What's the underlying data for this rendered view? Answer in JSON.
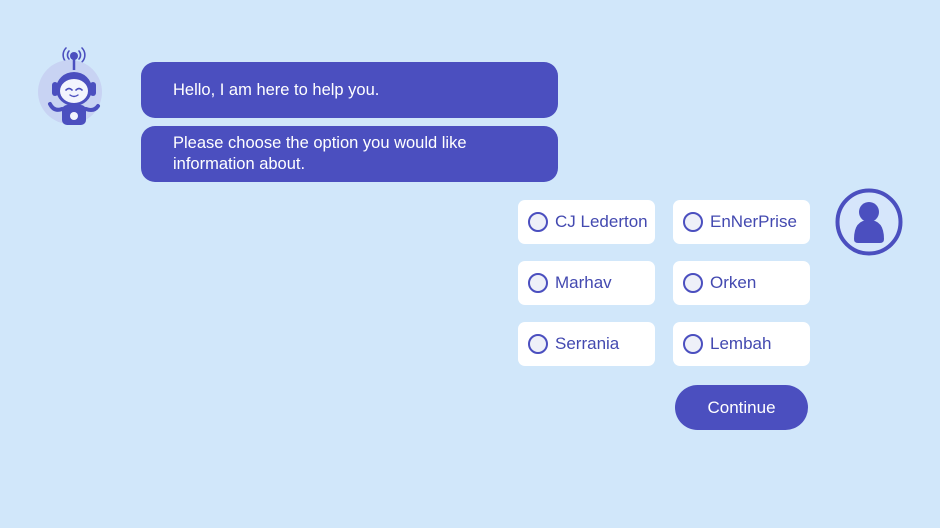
{
  "colors": {
    "background": "#d1e7fa",
    "accent": "#4b4fbf",
    "option_background": "#ffffff",
    "option_text": "#4349b0"
  },
  "bot": {
    "avatar_icon": "robot-icon"
  },
  "messages": [
    {
      "text": "Hello, I am here to help you."
    },
    {
      "text": "Please choose the option you would like information about."
    }
  ],
  "options": [
    {
      "label": "CJ Lederton",
      "selected": false
    },
    {
      "label": "EnNerPrise",
      "selected": false
    },
    {
      "label": "Marhav",
      "selected": false
    },
    {
      "label": "Orken",
      "selected": false
    },
    {
      "label": "Serrania",
      "selected": false
    },
    {
      "label": "Lembah",
      "selected": false
    }
  ],
  "continue_label": "Continue",
  "user": {
    "avatar_icon": "user-icon"
  }
}
